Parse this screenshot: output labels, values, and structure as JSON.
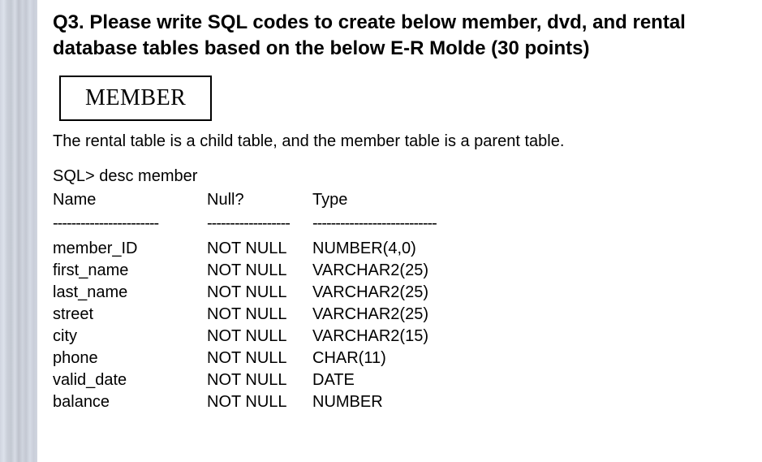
{
  "question": {
    "title": "Q3. Please write SQL codes to create below member, dvd, and rental database tables based on the below E-R Molde (30 points)"
  },
  "entity": {
    "name": "MEMBER"
  },
  "subtitle": "The rental table is a child table, and the member table is a parent table.",
  "sql": {
    "prompt": "SQL> desc member",
    "headers": {
      "name": "Name",
      "null": "Null?",
      "type": "Type"
    },
    "dashes": {
      "name": "-----------------------",
      "null": "------------------",
      "type": "---------------------------"
    },
    "rows": [
      {
        "name": "member_ID",
        "null": "NOT NULL",
        "type": "NUMBER(4,0)"
      },
      {
        "name": "first_name",
        "null": "NOT NULL",
        "type": "VARCHAR2(25)"
      },
      {
        "name": "last_name",
        "null": "NOT NULL",
        "type": "VARCHAR2(25)"
      },
      {
        "name": "street",
        "null": "NOT NULL",
        "type": "VARCHAR2(25)"
      },
      {
        "name": "city",
        "null": "NOT NULL",
        "type": "VARCHAR2(15)"
      },
      {
        "name": "phone",
        "null": "NOT NULL",
        "type": "CHAR(11)"
      },
      {
        "name": "valid_date",
        "null": "NOT NULL",
        "type": "DATE"
      },
      {
        "name": "balance",
        "null": "NOT NULL",
        "type": "NUMBER"
      }
    ]
  }
}
